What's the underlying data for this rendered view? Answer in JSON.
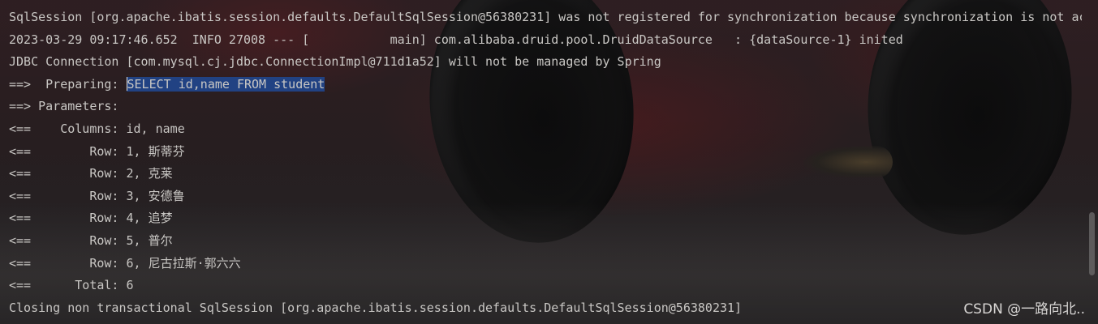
{
  "console": {
    "lines": [
      {
        "prefix": "SqlSession [org.apache.ibatis.session.defaults.DefaultSqlSession@56380231] was not registered for synchronization because synchronization is not active",
        "selected": "",
        "suffix": ""
      },
      {
        "prefix": "2023-03-29 09:17:46.652  INFO 27008 --- [           main] com.alibaba.druid.pool.DruidDataSource   : {dataSource-1} inited",
        "selected": "",
        "suffix": ""
      },
      {
        "prefix": "JDBC Connection [com.mysql.cj.jdbc.ConnectionImpl@711d1a52] will not be managed by Spring",
        "selected": "",
        "suffix": ""
      },
      {
        "prefix": "==>  Preparing: ",
        "selected": "SELECT id,name FROM student",
        "suffix": ""
      },
      {
        "prefix": "==> Parameters: ",
        "selected": "",
        "suffix": ""
      },
      {
        "prefix": "<==    Columns: id, name",
        "selected": "",
        "suffix": ""
      },
      {
        "prefix": "<==        Row: 1, 斯蒂芬",
        "selected": "",
        "suffix": ""
      },
      {
        "prefix": "<==        Row: 2, 克莱",
        "selected": "",
        "suffix": ""
      },
      {
        "prefix": "<==        Row: 3, 安德鲁",
        "selected": "",
        "suffix": ""
      },
      {
        "prefix": "<==        Row: 4, 追梦",
        "selected": "",
        "suffix": ""
      },
      {
        "prefix": "<==        Row: 5, 普尔",
        "selected": "",
        "suffix": ""
      },
      {
        "prefix": "<==        Row: 6, 尼古拉斯·郭六六",
        "selected": "",
        "suffix": ""
      },
      {
        "prefix": "<==      Total: 6",
        "selected": "",
        "suffix": ""
      },
      {
        "prefix": "Closing non transactional SqlSession [org.apache.ibatis.session.defaults.DefaultSqlSession@56380231]",
        "selected": "",
        "suffix": ""
      }
    ]
  },
  "watermark": "CSDN @一路向北..",
  "colors": {
    "text": "#c9c7c4",
    "selection": "#214283",
    "background": "#1f1d1e"
  }
}
